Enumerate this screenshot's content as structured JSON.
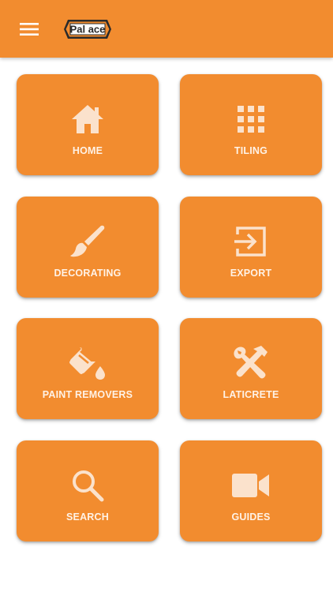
{
  "colors": {
    "accent": "#f28c2f",
    "icon_fill": "#fbe2cc",
    "label": "#fff2e6"
  },
  "appbar": {
    "menu_icon": "hamburger-menu-icon",
    "logo_text": "Pal ace"
  },
  "tiles": [
    {
      "label": "HOME",
      "icon": "home-icon"
    },
    {
      "label": "TILING",
      "icon": "grid-icon"
    },
    {
      "label": "DECORATING",
      "icon": "paintbrush-icon"
    },
    {
      "label": "EXPORT",
      "icon": "export-icon"
    },
    {
      "label": "PAINT REMOVERS",
      "icon": "paint-bucket-icon"
    },
    {
      "label": "LATICRETE",
      "icon": "tools-icon"
    },
    {
      "label": "SEARCH",
      "icon": "search-icon"
    },
    {
      "label": "GUIDES",
      "icon": "video-camera-icon"
    }
  ]
}
